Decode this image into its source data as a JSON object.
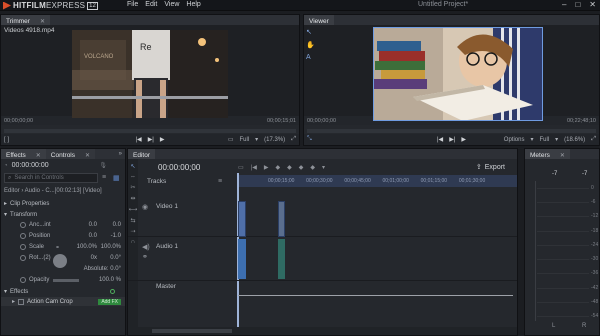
{
  "app": {
    "logo_text_bold": "HITFILM",
    "logo_text_light": "EXPRESS",
    "logo_version": "12",
    "project_title": "Untitled Project*",
    "window_controls": [
      "–",
      "□",
      "✕"
    ],
    "menu": [
      "File",
      "Edit",
      "View",
      "Help"
    ]
  },
  "trimmer": {
    "tab_label": "Trimmer",
    "clip_name": "Videos 4918.mp4",
    "time_start": "00;00;00;00",
    "time_end": "00;00;15;01",
    "scrub_progress": 0.0,
    "quality": "Full",
    "zoom": "(17.3%)",
    "transport": [
      "|◀",
      "▶|",
      "▶",
      "■"
    ]
  },
  "viewer": {
    "tab_label": "Viewer",
    "time_current": "00;00;00;00",
    "time_end": "00;22;48;10",
    "scrub_progress": 0.0,
    "options_label": "Options",
    "quality": "Full",
    "zoom": "(18.6%)"
  },
  "effects": {
    "tab_effects": "Effects",
    "tab_controls": "Controls",
    "timecode": "00:00:00:00",
    "search_placeholder": "Search in Controls",
    "editor_path": "Editor › Audio - C...[00:02:13] [Video]",
    "sections": {
      "clip_properties": "Clip Properties",
      "transform": "Transform",
      "effects": "Effects"
    },
    "props": [
      {
        "label": "Anc...int",
        "v1": "0.0",
        "v2": "0.0"
      },
      {
        "label": "Position",
        "v1": "0.0",
        "v2": "-1.0"
      },
      {
        "label": "Scale",
        "v1": "100.0%",
        "v2": "100.0%"
      },
      {
        "label": "Rot...(2)",
        "v1": "0x",
        "v2": "0.0°"
      },
      {
        "label": "Opacity",
        "v1": "",
        "v2": "100.0 %"
      }
    ],
    "rotation_absolute": "Absolute: 0.0°",
    "effect_item": "Action Cam Crop",
    "effect_button": "Add FX"
  },
  "editor": {
    "tab_label": "Editor",
    "timecode": "00:00:00;00",
    "export_label": "Export",
    "tracks_label": "Tracks",
    "video_track": "Video 1",
    "audio_track": "Audio 1",
    "master_track": "Master",
    "ruler_ticks": [
      "00;00;15;00",
      "00;00;30;00",
      "00;00;45;00",
      "00;01;00;00",
      "00;01;15;00",
      "00;01;30;00"
    ]
  },
  "meters": {
    "tab_label": "Meters",
    "peak_left": "-7",
    "peak_right": "-7",
    "scale": [
      "0",
      "-6",
      "-12",
      "-18",
      "-24",
      "-30",
      "-36",
      "-42",
      "-48",
      "-54"
    ],
    "channel_left": "L",
    "channel_right": "R"
  },
  "colors": {
    "accent": "#4a6ea8",
    "ruler": "#2f3a52",
    "selection": "#6f9be0",
    "fx_button": "#2f8a3e"
  }
}
